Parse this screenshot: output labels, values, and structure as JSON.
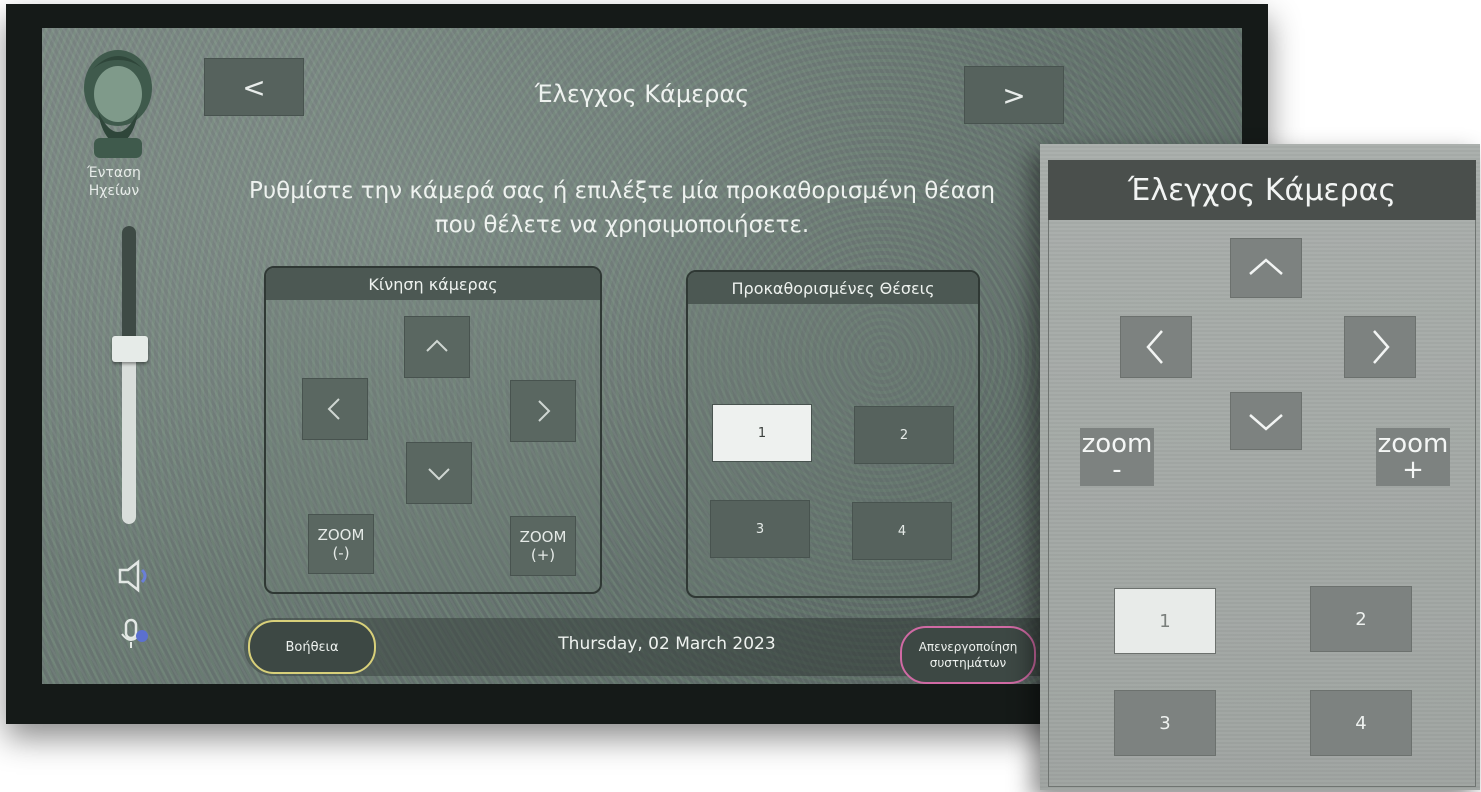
{
  "screen": {
    "title": "Έλεγχος Κάμερας",
    "instructions": "Ρυθμίστε την κάμερά σας ή επιλέξτε μία προκαθορισμένη θέαση που θέλετε να χρησιμοποιήσετε.",
    "nav": {
      "back": "<",
      "forward": ">"
    }
  },
  "sidebar": {
    "volume_label": "Ένταση Ηχείων",
    "volume_level_fraction": 0.6
  },
  "camera_move": {
    "title": "Κίνηση κάμερας",
    "zoom_out": {
      "line1": "ZOOM",
      "line2": "(-)"
    },
    "zoom_in": {
      "line1": "ZOOM",
      "line2": "(+)"
    }
  },
  "presets": {
    "title": "Προκαθορισμένες Θέσεις",
    "items": [
      "1",
      "2",
      "3",
      "4"
    ],
    "selected": "1"
  },
  "bottom_bar": {
    "help": "Βοήθεια",
    "date": "Thursday, 02 March 2023",
    "deactivate": {
      "line1": "Απενεργοποίηση",
      "line2": "συστημάτων"
    }
  },
  "inset": {
    "title": "Έλεγχος Κάμερας",
    "zoom_out": {
      "line1": "zoom",
      "line2": "-"
    },
    "zoom_in": {
      "line1": "zoom",
      "line2": "+"
    },
    "presets": [
      "1",
      "2",
      "3",
      "4"
    ],
    "selected": "1"
  },
  "colors": {
    "screen_bg": "#6a7a72",
    "button": "#56625d",
    "selected_preset": "#eef1ef",
    "help_border": "#d8d07a",
    "deactivate_border": "#d06aa4",
    "inset_bg": "#a9aeab",
    "inset_header": "#4a4f4c"
  },
  "icons": [
    "greek-bust-logo",
    "speaker-icon",
    "microphone-icon",
    "chevron-up-icon",
    "chevron-down-icon",
    "chevron-left-icon",
    "chevron-right-icon"
  ]
}
